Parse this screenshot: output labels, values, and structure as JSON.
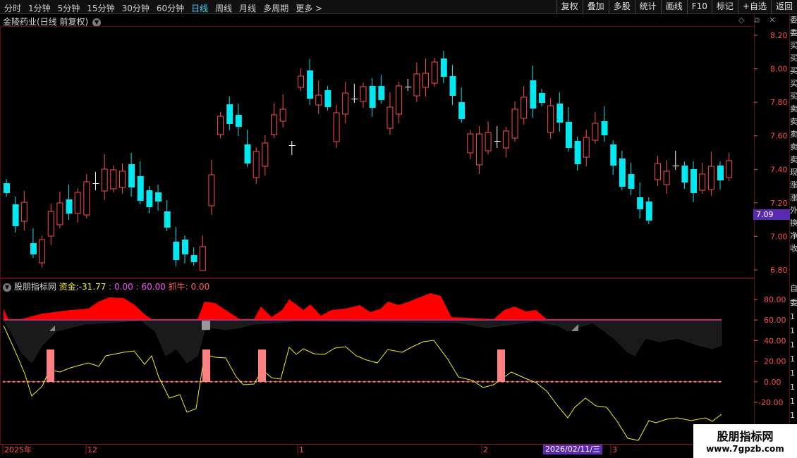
{
  "toolbar": {
    "periods": [
      "分时",
      "1分钟",
      "5分钟",
      "15分钟",
      "30分钟",
      "60分钟",
      "日线",
      "周线",
      "月线",
      "多周期",
      "更多 >"
    ],
    "active_period": "日线",
    "right_tools": [
      "复权",
      "叠加",
      "多股",
      "统计",
      "画线",
      "F10",
      "标记",
      "+自选",
      "返回"
    ]
  },
  "main_chart": {
    "title": "金陵药业(日线 前复权)",
    "title_icon": "chevron-down-icon",
    "tool_icons": [
      "diamond-icon",
      "restore-icon",
      "close-icon"
    ],
    "y_labels": [
      "8.20",
      "8.00",
      "7.80",
      "7.60",
      "7.40",
      "7.20",
      "7.00",
      "6.80"
    ],
    "current_price": "7.09",
    "colors": {
      "up": "#ff4c4c",
      "down": "#00e8f0",
      "doji": "#ffffff"
    }
  },
  "indicator": {
    "name": "股朋指标网",
    "zijin_label": "资金:",
    "zijin_value": "-31.77",
    "line_values": ": 0.00 : 60.00",
    "zhuaniu_label": "抓牛:",
    "zhuaniu_value": "0.00",
    "y_labels": [
      "80.00",
      "60.00",
      "40.00",
      "20.00",
      "0.00",
      "-20.00"
    ],
    "colors": {
      "positive_area": "#ff0000",
      "negative_area": "#000000",
      "money_line": "#f0f020",
      "line60": "#c040c0",
      "zero_line": "#ff4c4c",
      "signal_bar": "#ff8080"
    }
  },
  "x_axis": {
    "labels": [
      "2025年",
      "12",
      "1",
      "2",
      "3"
    ],
    "cursor_date": "2026/02/11/三"
  },
  "right_strip": [
    "委",
    "委",
    "买",
    "买",
    "买",
    "买",
    "买",
    "卖",
    "卖",
    "卖",
    "卖",
    "卖",
    "现",
    "涨",
    "涨",
    "外",
    "换",
    "净",
    "收"
  ],
  "indicator_right_strip": [
    "自",
    "委",
    "1",
    "1",
    "1",
    "1",
    "1",
    "1",
    "1",
    "1",
    "1",
    "1"
  ],
  "watermark": {
    "line1": "股朋指标网",
    "line2": "www.7gpzb.com"
  }
}
